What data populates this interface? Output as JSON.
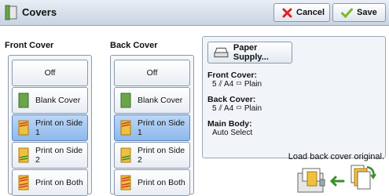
{
  "header": {
    "title": "Covers",
    "cancel_label": "Cancel",
    "save_label": "Save"
  },
  "front_cover": {
    "heading": "Front Cover",
    "options": [
      "Off",
      "Blank Cover",
      "Print on Side 1",
      "Print on Side 2",
      "Print on Both"
    ],
    "selected": "Print on Side 1"
  },
  "back_cover": {
    "heading": "Back Cover",
    "options": [
      "Off",
      "Blank Cover",
      "Print on Side 1",
      "Print on Side 2",
      "Print on Both"
    ],
    "selected": "Print on Side 1"
  },
  "info": {
    "paper_supply_label": "Paper Supply...",
    "front_label": "Front Cover:",
    "front_value": "5 ⫽ A4 ▭ Plain",
    "back_label": "Back Cover:",
    "back_value": "5 ⫽ A4 ▭ Plain",
    "main_label": "Main Body:",
    "main_value": "Auto Select"
  },
  "message": "Load back cover original.",
  "colors": {
    "selected": "#9cc2ef",
    "header": "#d4dce8"
  }
}
